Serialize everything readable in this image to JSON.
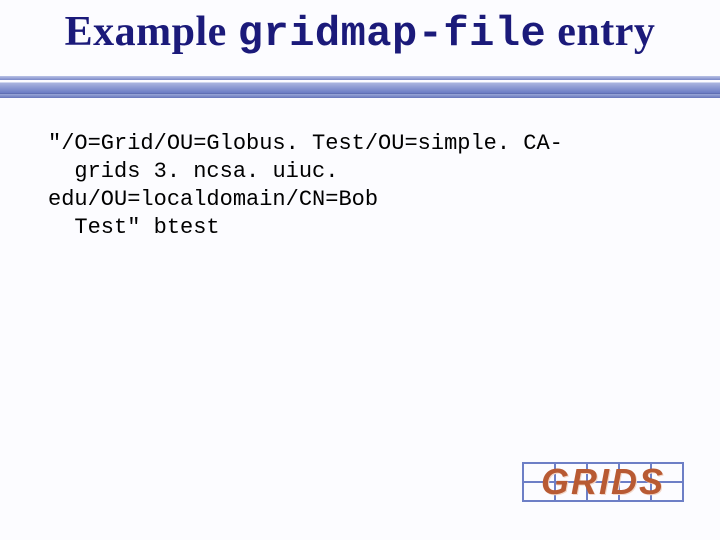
{
  "title": {
    "left": "Example ",
    "mono": "gridmap-file",
    "right": " entry"
  },
  "body": "\"/O=Grid/OU=Globus. Test/OU=simple. CA-\n  grids 3. ncsa. uiuc. edu/OU=localdomain/CN=Bob\n  Test\" btest",
  "logo": {
    "label": "GRIDS"
  }
}
